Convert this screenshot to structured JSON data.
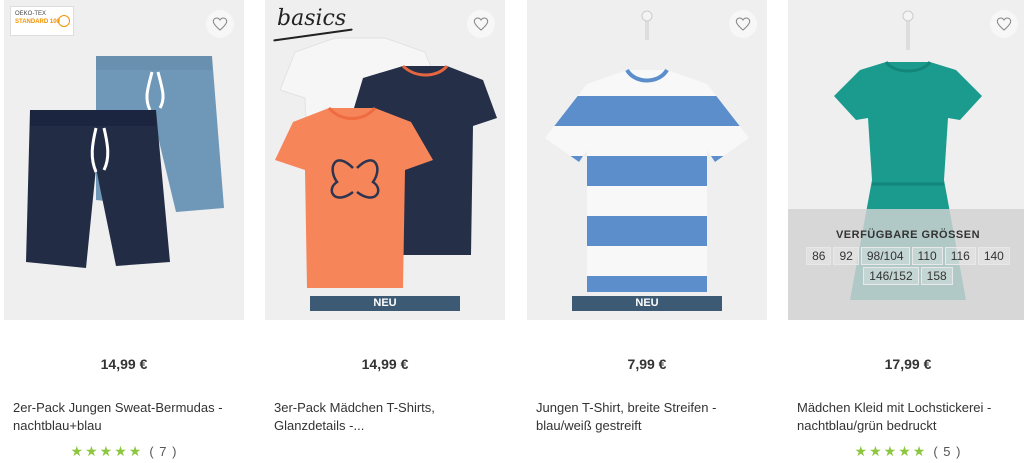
{
  "colors": {
    "accent_star": "#8dc63f",
    "badge_bg": "#3c5a73"
  },
  "products": [
    {
      "price": "14,99 €",
      "title": "2er-Pack Jungen Sweat-Bermudas - nachtblau+blau",
      "rating_stars": "★★★★★",
      "rating_count": "( 7 )",
      "badge": "",
      "label_oeko_1": "OEKO-TEX",
      "label_oeko_2": "STANDARD 100",
      "wishlist_icon": "heart-icon"
    },
    {
      "price": "14,99 €",
      "title": "3er-Pack Mädchen T-Shirts, Glanzdetails -...",
      "badge": "NEU",
      "label_basics": "basics",
      "wishlist_icon": "heart-icon"
    },
    {
      "price": "7,99 €",
      "title": "Jungen T-Shirt, breite Streifen - blau/weiß gestreift",
      "badge": "NEU",
      "wishlist_icon": "heart-icon"
    },
    {
      "price": "17,99 €",
      "title": "Mädchen Kleid mit Lochstickerei - nachtblau/grün bedruckt",
      "rating_stars": "★★★★★",
      "rating_count": "( 5 )",
      "sizes_title": "VERFÜGBARE GRÖSSEN",
      "sizes_row1": [
        "86",
        "92",
        "98/104",
        "110",
        "116",
        "140"
      ],
      "sizes_row2": [
        "146/152",
        "158"
      ],
      "wishlist_icon": "heart-icon"
    }
  ]
}
